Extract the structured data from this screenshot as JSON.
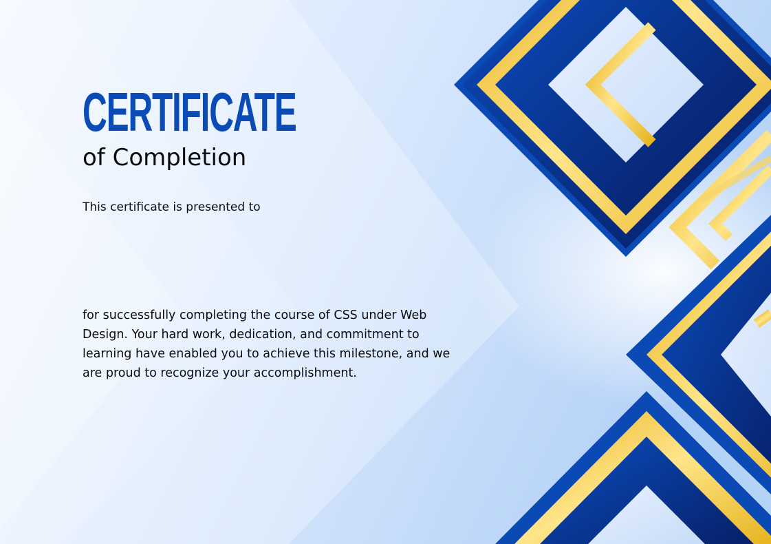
{
  "certificate": {
    "title": "CERTIFICATE",
    "subtitle": "of Completion",
    "presented_to": "This certificate is presented to",
    "recipient_name": "",
    "body_lines": [
      "for successfully completing the course of CSS under Web",
      "Design. Your hard work, dedication, and commitment to",
      "learning have enabled you to achieve this milestone, and we",
      "are proud to recognize your accomplishment."
    ]
  },
  "colors": {
    "title_blue": "#0a4bb5",
    "navy": "#0a1f6e",
    "royal_blue": "#0b49b5",
    "gold": "#f0c63a",
    "background_light": "#eaf2ff",
    "background_blue": "#bcd6f8",
    "text": "#0b0b10"
  },
  "decorations": [
    "nested-diamond-top-right",
    "partial-diamond-right-edge",
    "partial-diamond-bottom"
  ]
}
